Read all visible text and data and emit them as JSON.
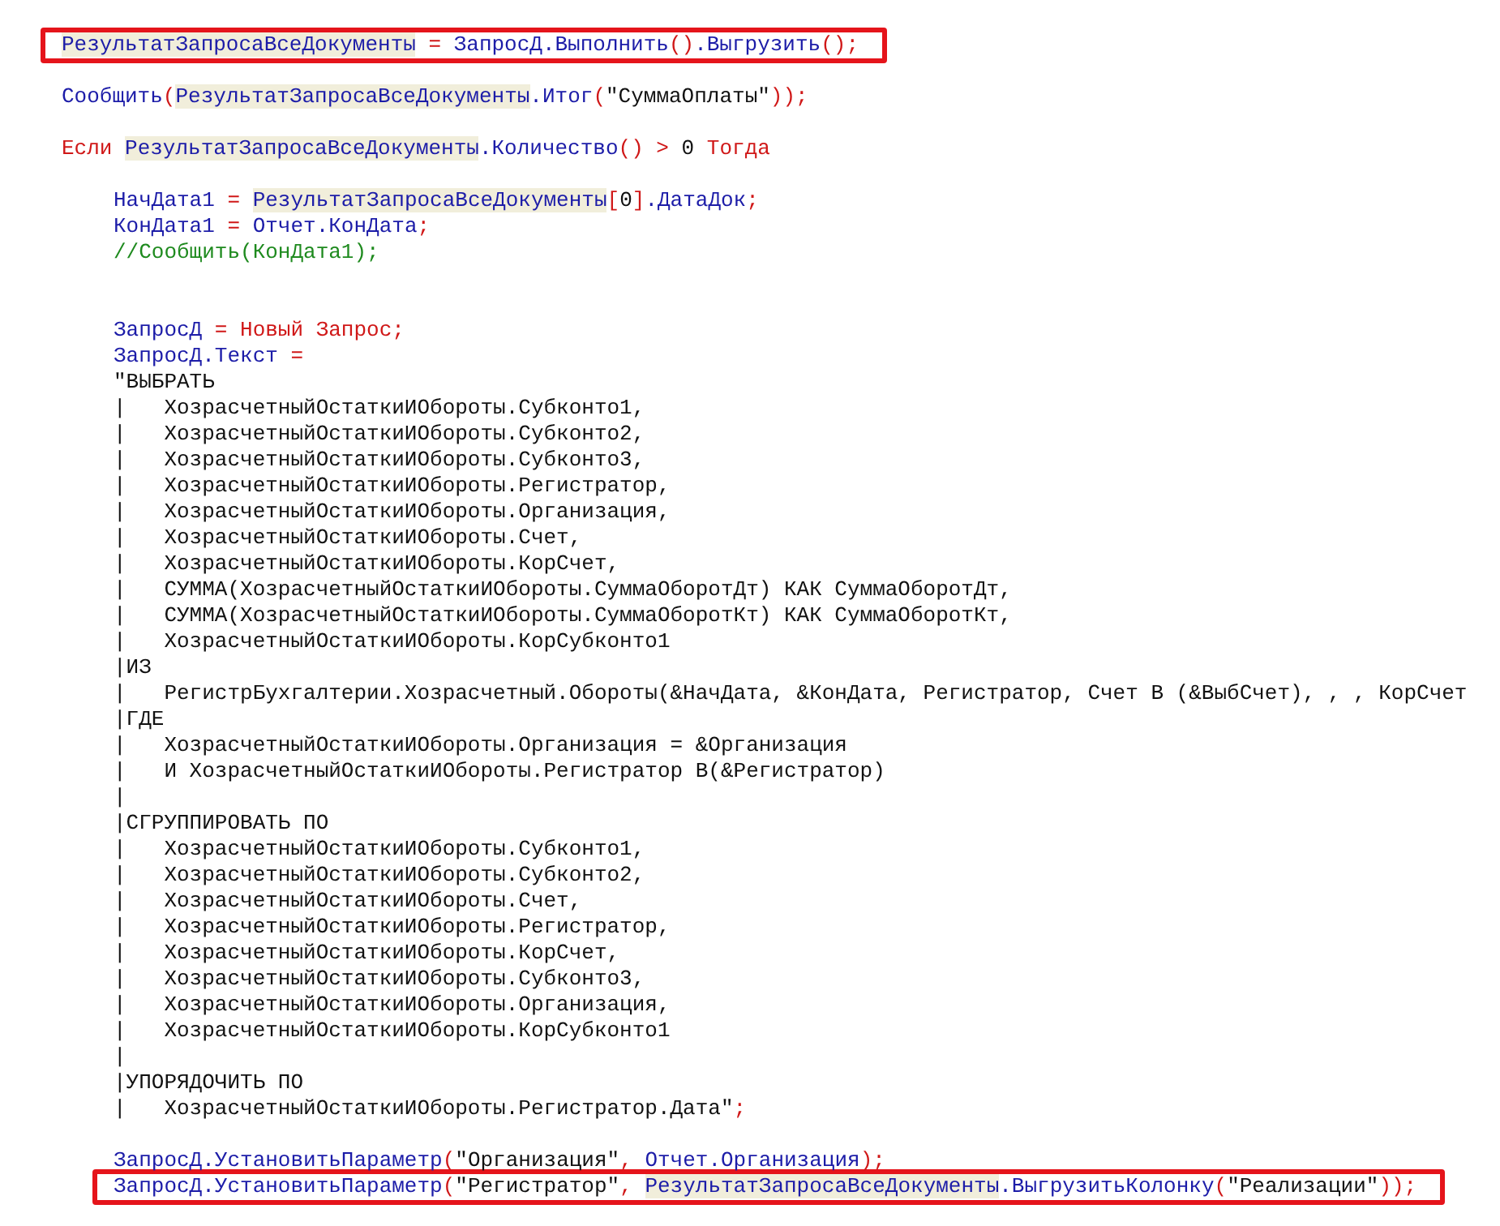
{
  "editor": {
    "lines": [
      {
        "kind": "code",
        "boxed": true,
        "tokens": [
          {
            "kind": "hl",
            "text": "РезультатЗапросаВсеДокументы"
          },
          {
            "kind": "op",
            "text": " = "
          },
          {
            "kind": "id",
            "text": "ЗапросД.Выполнить"
          },
          {
            "kind": "op",
            "text": "()"
          },
          {
            "kind": "id",
            "text": ".Выгрузить"
          },
          {
            "kind": "op",
            "text": "();"
          }
        ]
      },
      {
        "kind": "blank"
      },
      {
        "kind": "code",
        "boxed": false,
        "tokens": [
          {
            "kind": "id",
            "text": "Сообщить"
          },
          {
            "kind": "op",
            "text": "("
          },
          {
            "kind": "hl",
            "text": "РезультатЗапросаВсеДокументы"
          },
          {
            "kind": "id",
            "text": ".Итог"
          },
          {
            "kind": "op",
            "text": "("
          },
          {
            "kind": "str",
            "text": "\"СуммаОплаты\""
          },
          {
            "kind": "op",
            "text": "));"
          }
        ]
      },
      {
        "kind": "blank"
      },
      {
        "kind": "code",
        "boxed": false,
        "tokens": [
          {
            "kind": "kw",
            "text": "Если "
          },
          {
            "kind": "hl",
            "text": "РезультатЗапросаВсеДокументы"
          },
          {
            "kind": "id",
            "text": ".Количество"
          },
          {
            "kind": "op",
            "text": "() > "
          },
          {
            "kind": "num",
            "text": "0"
          },
          {
            "kind": "kw",
            "text": " Тогда"
          }
        ],
        "children": [
          {
            "kind": "blank"
          },
          {
            "kind": "code",
            "boxed": false,
            "tokens": [
              {
                "kind": "id",
                "text": "НачДата1"
              },
              {
                "kind": "op",
                "text": " = "
              },
              {
                "kind": "hl",
                "text": "РезультатЗапросаВсеДокументы"
              },
              {
                "kind": "op",
                "text": "["
              },
              {
                "kind": "num",
                "text": "0"
              },
              {
                "kind": "op",
                "text": "]"
              },
              {
                "kind": "id",
                "text": ".ДатаДок"
              },
              {
                "kind": "op",
                "text": ";"
              }
            ]
          },
          {
            "kind": "code",
            "boxed": false,
            "tokens": [
              {
                "kind": "id",
                "text": "КонДата1"
              },
              {
                "kind": "op",
                "text": " = "
              },
              {
                "kind": "id",
                "text": "Отчет.КонДата"
              },
              {
                "kind": "op",
                "text": ";"
              }
            ]
          },
          {
            "kind": "code",
            "boxed": false,
            "tokens": [
              {
                "kind": "comment",
                "text": "//Сообщить(КонДата1);"
              }
            ]
          },
          {
            "kind": "blank"
          },
          {
            "kind": "blank"
          },
          {
            "kind": "code",
            "boxed": false,
            "tokens": [
              {
                "kind": "id",
                "text": "ЗапросД"
              },
              {
                "kind": "op",
                "text": " = "
              },
              {
                "kind": "kw",
                "text": "Новый Запрос"
              },
              {
                "kind": "op",
                "text": ";"
              }
            ]
          },
          {
            "kind": "code",
            "boxed": false,
            "tokens": [
              {
                "kind": "id",
                "text": "ЗапросД.Текст"
              },
              {
                "kind": "op",
                "text": " ="
              }
            ]
          },
          {
            "kind": "code",
            "boxed": false,
            "tokens": [
              {
                "kind": "str",
                "text": "\"ВЫБРАТЬ"
              }
            ]
          },
          {
            "kind": "code",
            "boxed": false,
            "tokens": [
              {
                "kind": "str",
                "text": "|   ХозрасчетныйОстаткиИОбороты.Субконто1,"
              }
            ]
          },
          {
            "kind": "code",
            "boxed": false,
            "tokens": [
              {
                "kind": "str",
                "text": "|   ХозрасчетныйОстаткиИОбороты.Субконто2,"
              }
            ]
          },
          {
            "kind": "code",
            "boxed": false,
            "tokens": [
              {
                "kind": "str",
                "text": "|   ХозрасчетныйОстаткиИОбороты.Субконто3,"
              }
            ]
          },
          {
            "kind": "code",
            "boxed": false,
            "tokens": [
              {
                "kind": "str",
                "text": "|   ХозрасчетныйОстаткиИОбороты.Регистратор,"
              }
            ]
          },
          {
            "kind": "code",
            "boxed": false,
            "tokens": [
              {
                "kind": "str",
                "text": "|   ХозрасчетныйОстаткиИОбороты.Организация,"
              }
            ]
          },
          {
            "kind": "code",
            "boxed": false,
            "tokens": [
              {
                "kind": "str",
                "text": "|   ХозрасчетныйОстаткиИОбороты.Счет,"
              }
            ]
          },
          {
            "kind": "code",
            "boxed": false,
            "tokens": [
              {
                "kind": "str",
                "text": "|   ХозрасчетныйОстаткиИОбороты.КорСчет,"
              }
            ]
          },
          {
            "kind": "code",
            "boxed": false,
            "tokens": [
              {
                "kind": "str",
                "text": "|   СУММА(ХозрасчетныйОстаткиИОбороты.СуммаОборотДт) КАК СуммаОборотДт,"
              }
            ]
          },
          {
            "kind": "code",
            "boxed": false,
            "tokens": [
              {
                "kind": "str",
                "text": "|   СУММА(ХозрасчетныйОстаткиИОбороты.СуммаОборотКт) КАК СуммаОборотКт,"
              }
            ]
          },
          {
            "kind": "code",
            "boxed": false,
            "tokens": [
              {
                "kind": "str",
                "text": "|   ХозрасчетныйОстаткиИОбороты.КорСубконто1"
              }
            ]
          },
          {
            "kind": "code",
            "boxed": false,
            "tokens": [
              {
                "kind": "str",
                "text": "|ИЗ"
              }
            ]
          },
          {
            "kind": "code",
            "boxed": false,
            "tokens": [
              {
                "kind": "str",
                "text": "|   РегистрБухгалтерии.Хозрасчетный.Обороты(&НачДата, &КонДата, Регистратор, Счет В (&ВыбСчет), , , КорСчет"
              }
            ]
          },
          {
            "kind": "code",
            "boxed": false,
            "tokens": [
              {
                "kind": "str",
                "text": "|ГДЕ"
              }
            ]
          },
          {
            "kind": "code",
            "boxed": false,
            "tokens": [
              {
                "kind": "str",
                "text": "|   ХозрасчетныйОстаткиИОбороты.Организация = &Организация"
              }
            ]
          },
          {
            "kind": "code",
            "boxed": false,
            "tokens": [
              {
                "kind": "str",
                "text": "|   И ХозрасчетныйОстаткиИОбороты.Регистратор В(&Регистратор)"
              }
            ]
          },
          {
            "kind": "code",
            "boxed": false,
            "tokens": [
              {
                "kind": "str",
                "text": "|"
              }
            ]
          },
          {
            "kind": "code",
            "boxed": false,
            "tokens": [
              {
                "kind": "str",
                "text": "|СГРУППИРОВАТЬ ПО"
              }
            ]
          },
          {
            "kind": "code",
            "boxed": false,
            "tokens": [
              {
                "kind": "str",
                "text": "|   ХозрасчетныйОстаткиИОбороты.Субконто1,"
              }
            ]
          },
          {
            "kind": "code",
            "boxed": false,
            "tokens": [
              {
                "kind": "str",
                "text": "|   ХозрасчетныйОстаткиИОбороты.Субконто2,"
              }
            ]
          },
          {
            "kind": "code",
            "boxed": false,
            "tokens": [
              {
                "kind": "str",
                "text": "|   ХозрасчетныйОстаткиИОбороты.Счет,"
              }
            ]
          },
          {
            "kind": "code",
            "boxed": false,
            "tokens": [
              {
                "kind": "str",
                "text": "|   ХозрасчетныйОстаткиИОбороты.Регистратор,"
              }
            ]
          },
          {
            "kind": "code",
            "boxed": false,
            "tokens": [
              {
                "kind": "str",
                "text": "|   ХозрасчетныйОстаткиИОбороты.КорСчет,"
              }
            ]
          },
          {
            "kind": "code",
            "boxed": false,
            "tokens": [
              {
                "kind": "str",
                "text": "|   ХозрасчетныйОстаткиИОбороты.Субконто3,"
              }
            ]
          },
          {
            "kind": "code",
            "boxed": false,
            "tokens": [
              {
                "kind": "str",
                "text": "|   ХозрасчетныйОстаткиИОбороты.Организация,"
              }
            ]
          },
          {
            "kind": "code",
            "boxed": false,
            "tokens": [
              {
                "kind": "str",
                "text": "|   ХозрасчетныйОстаткиИОбороты.КорСубконто1"
              }
            ]
          },
          {
            "kind": "code",
            "boxed": false,
            "tokens": [
              {
                "kind": "str",
                "text": "|"
              }
            ]
          },
          {
            "kind": "code",
            "boxed": false,
            "tokens": [
              {
                "kind": "str",
                "text": "|УПОРЯДОЧИТЬ ПО"
              }
            ]
          },
          {
            "kind": "code",
            "boxed": false,
            "tokens": [
              {
                "kind": "str",
                "text": "|   ХозрасчетныйОстаткиИОбороты.Регистратор.Дата\""
              },
              {
                "kind": "op",
                "text": ";"
              }
            ]
          },
          {
            "kind": "blank"
          },
          {
            "kind": "code",
            "boxed": false,
            "tokens": [
              {
                "kind": "id",
                "text": "ЗапросД.УстановитьПараметр"
              },
              {
                "kind": "op",
                "text": "("
              },
              {
                "kind": "str",
                "text": "\"Организация\""
              },
              {
                "kind": "op",
                "text": ", "
              },
              {
                "kind": "id",
                "text": "Отчет.Организация"
              },
              {
                "kind": "op",
                "text": ");"
              }
            ]
          },
          {
            "kind": "code",
            "boxed": true,
            "tokens": [
              {
                "kind": "id",
                "text": "ЗапросД.УстановитьПараметр"
              },
              {
                "kind": "op",
                "text": "("
              },
              {
                "kind": "str",
                "text": "\"Регистратор\""
              },
              {
                "kind": "op",
                "text": ", "
              },
              {
                "kind": "hl",
                "text": "РезультатЗапросаВсеДокументы"
              },
              {
                "kind": "id",
                "text": ".ВыгрузитьКолонку"
              },
              {
                "kind": "op",
                "text": "("
              },
              {
                "kind": "str",
                "text": "\"Реализации\""
              },
              {
                "kind": "op",
                "text": "));"
              }
            ]
          }
        ]
      }
    ]
  }
}
